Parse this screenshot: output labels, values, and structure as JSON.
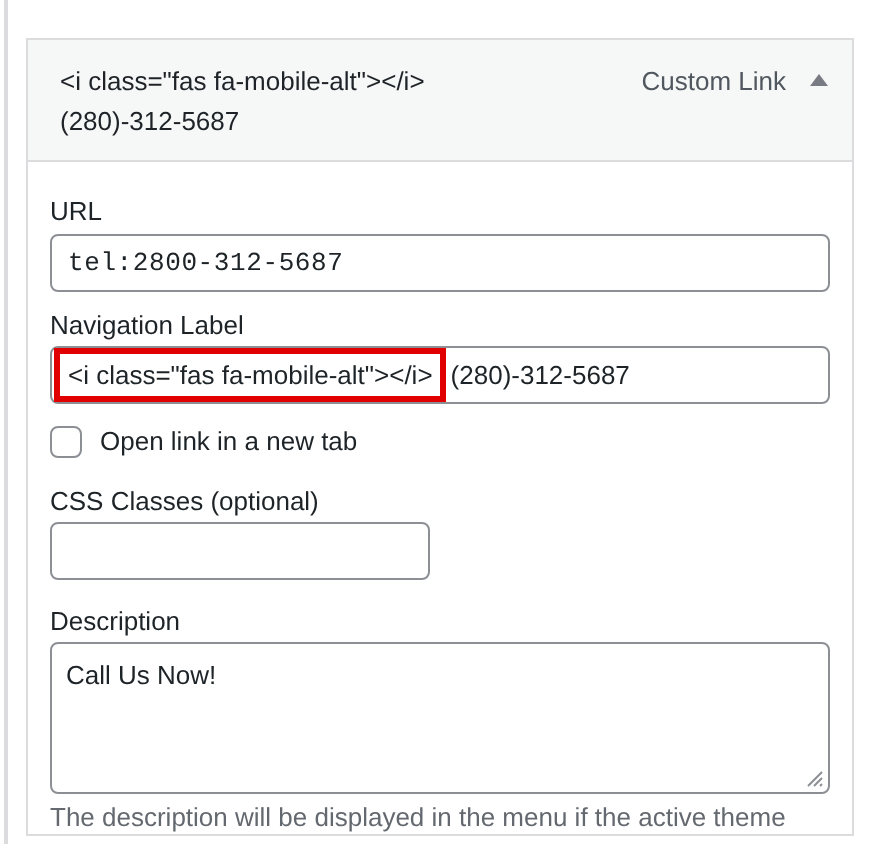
{
  "menu_item": {
    "title": "<i class=\"fas fa-mobile-alt\"></i> (280)-312-5687",
    "type": "Custom Link",
    "expanded": true
  },
  "url": {
    "label": "URL",
    "value": "tel:2800-312-5687"
  },
  "navigation_label": {
    "label": "Navigation Label",
    "value_parts": [
      {
        "text": "<i class=\"fas fa-mobile-alt\"></i>",
        "highlighted": true
      },
      {
        "text": "(280)-312-5687",
        "highlighted": false
      }
    ]
  },
  "open_new_tab": {
    "label": "Open link in a new tab",
    "checked": false
  },
  "css_classes": {
    "label": "CSS Classes (optional)"
  },
  "description": {
    "label": "Description",
    "value": "Call Us Now!",
    "help": "The description will be displayed in the menu if the active theme"
  }
}
